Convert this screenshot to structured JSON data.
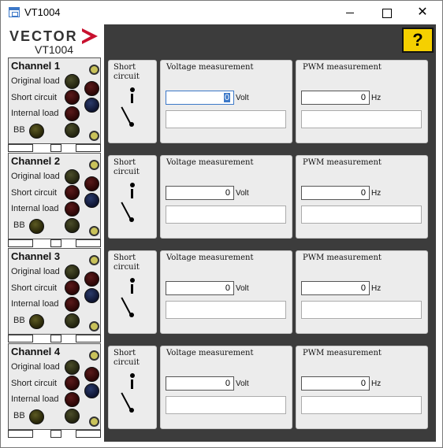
{
  "window": {
    "title": "VT1004",
    "close_glyph": "✕"
  },
  "logo": {
    "brand": "VECTOR",
    "model": "VT1004",
    "accent_color": "#c8102e"
  },
  "help": {
    "label": "?"
  },
  "device_labels": {
    "original_load": "Original load",
    "short_circuit": "Short circuit",
    "internal_load": "Internal load",
    "bb": "BB"
  },
  "channels": [
    {
      "name": "Channel 1"
    },
    {
      "name": "Channel 2"
    },
    {
      "name": "Channel 3"
    },
    {
      "name": "Channel 4"
    }
  ],
  "panel_labels": {
    "short_circuit_line1": "Short",
    "short_circuit_line2": "circuit",
    "voltage_title": "Voltage measurement",
    "pwm_title": "PWM measurement",
    "volt_unit": "Volt",
    "hz_unit": "Hz"
  },
  "measurements": [
    {
      "voltage": "0",
      "pwm": "0"
    },
    {
      "voltage": "0",
      "pwm": "0"
    },
    {
      "voltage": "0",
      "pwm": "0"
    },
    {
      "voltage": "0",
      "pwm": "0"
    }
  ]
}
